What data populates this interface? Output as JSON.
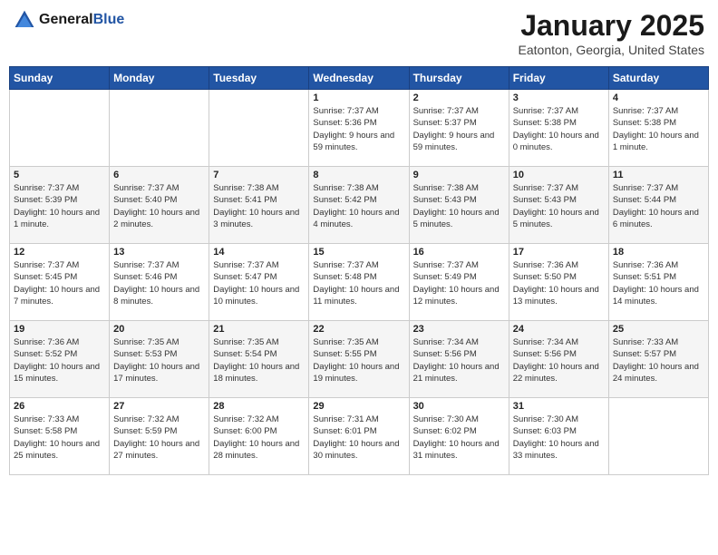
{
  "header": {
    "logo_general": "General",
    "logo_blue": "Blue",
    "month": "January 2025",
    "location": "Eatonton, Georgia, United States"
  },
  "days_of_week": [
    "Sunday",
    "Monday",
    "Tuesday",
    "Wednesday",
    "Thursday",
    "Friday",
    "Saturday"
  ],
  "weeks": [
    [
      {
        "day": "",
        "info": ""
      },
      {
        "day": "",
        "info": ""
      },
      {
        "day": "",
        "info": ""
      },
      {
        "day": "1",
        "info": "Sunrise: 7:37 AM\nSunset: 5:36 PM\nDaylight: 9 hours and 59 minutes."
      },
      {
        "day": "2",
        "info": "Sunrise: 7:37 AM\nSunset: 5:37 PM\nDaylight: 9 hours and 59 minutes."
      },
      {
        "day": "3",
        "info": "Sunrise: 7:37 AM\nSunset: 5:38 PM\nDaylight: 10 hours and 0 minutes."
      },
      {
        "day": "4",
        "info": "Sunrise: 7:37 AM\nSunset: 5:38 PM\nDaylight: 10 hours and 1 minute."
      }
    ],
    [
      {
        "day": "5",
        "info": "Sunrise: 7:37 AM\nSunset: 5:39 PM\nDaylight: 10 hours and 1 minute."
      },
      {
        "day": "6",
        "info": "Sunrise: 7:37 AM\nSunset: 5:40 PM\nDaylight: 10 hours and 2 minutes."
      },
      {
        "day": "7",
        "info": "Sunrise: 7:38 AM\nSunset: 5:41 PM\nDaylight: 10 hours and 3 minutes."
      },
      {
        "day": "8",
        "info": "Sunrise: 7:38 AM\nSunset: 5:42 PM\nDaylight: 10 hours and 4 minutes."
      },
      {
        "day": "9",
        "info": "Sunrise: 7:38 AM\nSunset: 5:43 PM\nDaylight: 10 hours and 5 minutes."
      },
      {
        "day": "10",
        "info": "Sunrise: 7:37 AM\nSunset: 5:43 PM\nDaylight: 10 hours and 5 minutes."
      },
      {
        "day": "11",
        "info": "Sunrise: 7:37 AM\nSunset: 5:44 PM\nDaylight: 10 hours and 6 minutes."
      }
    ],
    [
      {
        "day": "12",
        "info": "Sunrise: 7:37 AM\nSunset: 5:45 PM\nDaylight: 10 hours and 7 minutes."
      },
      {
        "day": "13",
        "info": "Sunrise: 7:37 AM\nSunset: 5:46 PM\nDaylight: 10 hours and 8 minutes."
      },
      {
        "day": "14",
        "info": "Sunrise: 7:37 AM\nSunset: 5:47 PM\nDaylight: 10 hours and 10 minutes."
      },
      {
        "day": "15",
        "info": "Sunrise: 7:37 AM\nSunset: 5:48 PM\nDaylight: 10 hours and 11 minutes."
      },
      {
        "day": "16",
        "info": "Sunrise: 7:37 AM\nSunset: 5:49 PM\nDaylight: 10 hours and 12 minutes."
      },
      {
        "day": "17",
        "info": "Sunrise: 7:36 AM\nSunset: 5:50 PM\nDaylight: 10 hours and 13 minutes."
      },
      {
        "day": "18",
        "info": "Sunrise: 7:36 AM\nSunset: 5:51 PM\nDaylight: 10 hours and 14 minutes."
      }
    ],
    [
      {
        "day": "19",
        "info": "Sunrise: 7:36 AM\nSunset: 5:52 PM\nDaylight: 10 hours and 15 minutes."
      },
      {
        "day": "20",
        "info": "Sunrise: 7:35 AM\nSunset: 5:53 PM\nDaylight: 10 hours and 17 minutes."
      },
      {
        "day": "21",
        "info": "Sunrise: 7:35 AM\nSunset: 5:54 PM\nDaylight: 10 hours and 18 minutes."
      },
      {
        "day": "22",
        "info": "Sunrise: 7:35 AM\nSunset: 5:55 PM\nDaylight: 10 hours and 19 minutes."
      },
      {
        "day": "23",
        "info": "Sunrise: 7:34 AM\nSunset: 5:56 PM\nDaylight: 10 hours and 21 minutes."
      },
      {
        "day": "24",
        "info": "Sunrise: 7:34 AM\nSunset: 5:56 PM\nDaylight: 10 hours and 22 minutes."
      },
      {
        "day": "25",
        "info": "Sunrise: 7:33 AM\nSunset: 5:57 PM\nDaylight: 10 hours and 24 minutes."
      }
    ],
    [
      {
        "day": "26",
        "info": "Sunrise: 7:33 AM\nSunset: 5:58 PM\nDaylight: 10 hours and 25 minutes."
      },
      {
        "day": "27",
        "info": "Sunrise: 7:32 AM\nSunset: 5:59 PM\nDaylight: 10 hours and 27 minutes."
      },
      {
        "day": "28",
        "info": "Sunrise: 7:32 AM\nSunset: 6:00 PM\nDaylight: 10 hours and 28 minutes."
      },
      {
        "day": "29",
        "info": "Sunrise: 7:31 AM\nSunset: 6:01 PM\nDaylight: 10 hours and 30 minutes."
      },
      {
        "day": "30",
        "info": "Sunrise: 7:30 AM\nSunset: 6:02 PM\nDaylight: 10 hours and 31 minutes."
      },
      {
        "day": "31",
        "info": "Sunrise: 7:30 AM\nSunset: 6:03 PM\nDaylight: 10 hours and 33 minutes."
      },
      {
        "day": "",
        "info": ""
      }
    ]
  ]
}
